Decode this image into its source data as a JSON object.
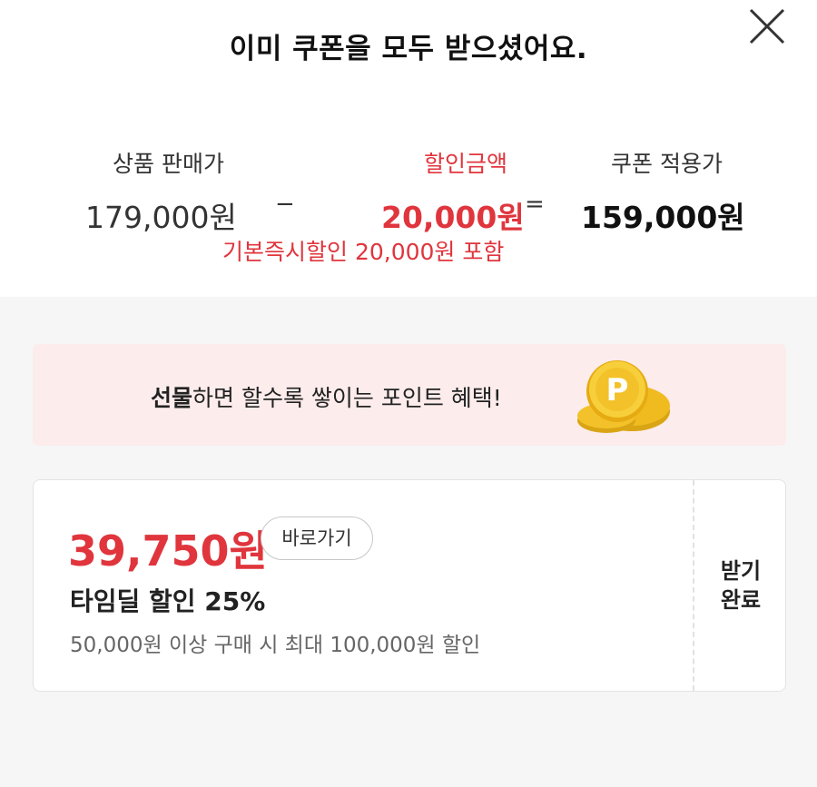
{
  "header": {
    "title": "이미 쿠폰을 모두 받으셨어요."
  },
  "summary": {
    "price_label": "상품 판매가",
    "price_value": "179,000원",
    "minus_sign": "−",
    "discount_label": "할인금액",
    "discount_value": "20,000원",
    "equals_sign": "=",
    "final_label": "쿠폰 적용가",
    "final_value": "159,000원",
    "discount_note": "기본즉시할인 20,000원 포함"
  },
  "banner": {
    "highlight": "선물",
    "text": "하면 할수록 쌓이는 포인트 혜택!",
    "coin_letter": "P"
  },
  "coupon": {
    "price": "39,750원",
    "goto_label": "바로가기",
    "name": "타임딜 할인 25%",
    "description": "50,000원 이상 구매 시 최대 100,000원 할인",
    "status_line1": "받기",
    "status_line2": "완료"
  },
  "colors": {
    "accent_red": "#e0353d",
    "banner_bg": "#fcecec",
    "coin_gold": "#f3c22a"
  },
  "icons": {
    "close": "close-icon",
    "coin": "point-coin-icon"
  }
}
